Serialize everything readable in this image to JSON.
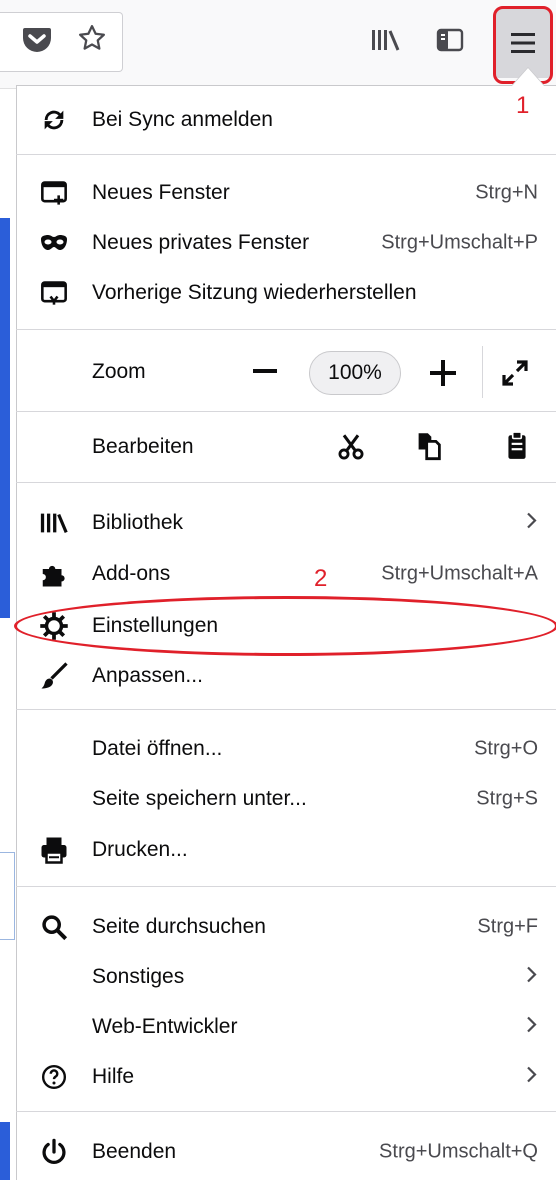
{
  "colors": {
    "annotation": "#e0202a",
    "accent_blue": "#2b5ed9",
    "menu_button_bg": "#d7d7db"
  },
  "toolbar": {
    "icons": [
      "pocket-icon",
      "bookmark-star-icon",
      "library-icon",
      "sidebar-icon",
      "hamburger-menu-icon"
    ]
  },
  "annotations": {
    "step1": "1",
    "step2": "2"
  },
  "menu": {
    "sync": {
      "label": "Bei Sync anmelden",
      "icon": "sync-icon"
    },
    "new_window": {
      "label": "Neues Fenster",
      "shortcut": "Strg+N",
      "icon": "new-window-icon"
    },
    "private_window": {
      "label": "Neues privates Fenster",
      "shortcut": "Strg+Umschalt+P",
      "icon": "private-mask-icon"
    },
    "restore_session": {
      "label": "Vorherige Sitzung wiederherstellen",
      "icon": "restore-session-icon"
    },
    "zoom": {
      "label": "Zoom",
      "value": "100%",
      "minus": "−",
      "plus": "+"
    },
    "edit": {
      "label": "Bearbeiten",
      "icons": [
        "cut-icon",
        "copy-icon",
        "paste-icon"
      ]
    },
    "library": {
      "label": "Bibliothek",
      "icon": "library-icon"
    },
    "addons": {
      "label": "Add-ons",
      "shortcut": "Strg+Umschalt+A",
      "icon": "puzzle-icon"
    },
    "settings": {
      "label": "Einstellungen",
      "icon": "gear-icon"
    },
    "customize": {
      "label": "Anpassen...",
      "icon": "paintbrush-icon"
    },
    "open_file": {
      "label": "Datei öffnen...",
      "shortcut": "Strg+O"
    },
    "save_page": {
      "label": "Seite speichern unter...",
      "shortcut": "Strg+S"
    },
    "print": {
      "label": "Drucken...",
      "icon": "printer-icon"
    },
    "find": {
      "label": "Seite durchsuchen",
      "shortcut": "Strg+F",
      "icon": "search-icon"
    },
    "more": {
      "label": "Sonstiges"
    },
    "web_dev": {
      "label": "Web-Entwickler"
    },
    "help": {
      "label": "Hilfe",
      "icon": "help-icon"
    },
    "quit": {
      "label": "Beenden",
      "shortcut": "Strg+Umschalt+Q",
      "icon": "power-icon"
    }
  }
}
